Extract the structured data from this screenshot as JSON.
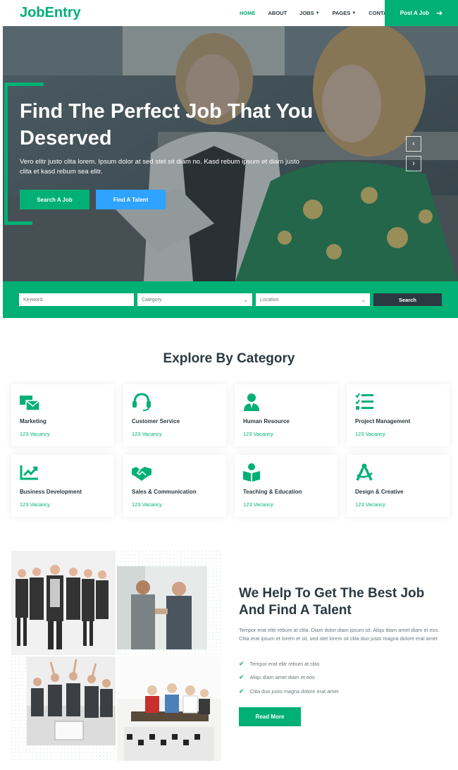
{
  "colors": {
    "primary": "#00B074",
    "secondary": "#2EA3FF",
    "dark": "#2B3940"
  },
  "brand": "JobEntry",
  "nav": {
    "links": [
      {
        "label": "HOME",
        "active": true
      },
      {
        "label": "ABOUT"
      },
      {
        "label": "JOBS",
        "has_caret": true
      },
      {
        "label": "PAGES",
        "has_caret": true
      },
      {
        "label": "CONTACT"
      }
    ],
    "post_job": "Post A Job",
    "post_job_icon": "arrow-right-icon"
  },
  "hero": {
    "title": "Find The Perfect Job That You Deserved",
    "text": "Vero elitr justo clita lorem. Ipsum dolor at sed stet sit diam no. Kasd rebum ipsum et diam justo clita et kasd rebum sea elitr.",
    "btn_search": "Search A Job",
    "btn_talent": "Find A Talent",
    "prev_icon": "chevron-left-icon",
    "next_icon": "chevron-right-icon"
  },
  "search": {
    "keyword_placeholder": "Keyword",
    "category_label": "Category",
    "location_label": "Location",
    "button": "Search"
  },
  "categories": {
    "title": "Explore By Category",
    "items": [
      {
        "name": "Marketing",
        "vacancy": "123 Vacancy",
        "icon": "mail-bulk-icon"
      },
      {
        "name": "Customer Service",
        "vacancy": "123 Vacancy",
        "icon": "headset-icon"
      },
      {
        "name": "Human Resource",
        "vacancy": "123 Vacancy",
        "icon": "user-tie-icon"
      },
      {
        "name": "Project Management",
        "vacancy": "123 Vacancy",
        "icon": "tasks-icon"
      },
      {
        "name": "Business Development",
        "vacancy": "123 Vacancy",
        "icon": "chart-line-icon"
      },
      {
        "name": "Sales & Communication",
        "vacancy": "123 Vacancy",
        "icon": "handshake-icon"
      },
      {
        "name": "Teaching & Education",
        "vacancy": "123 Vacancy",
        "icon": "book-reader-icon"
      },
      {
        "name": "Design & Creative",
        "vacancy": "123 Vacancy",
        "icon": "drafting-compass-icon"
      }
    ]
  },
  "about": {
    "title": "We Help To Get The Best Job And Find A Talent",
    "text": "Tempor erat elitr rebum at clita. Diam dolor diam ipsum sit. Aliqu diam amet diam et eos. Clita erat ipsum et lorem et sit, sed stet lorem sit clita duo justo magna dolore erat amet",
    "checks": [
      "Tempor erat elitr rebum at clita",
      "Aliqu diam amet diam et eos",
      "Clita duo justo magna dolore erat amet"
    ],
    "button": "Read More"
  }
}
